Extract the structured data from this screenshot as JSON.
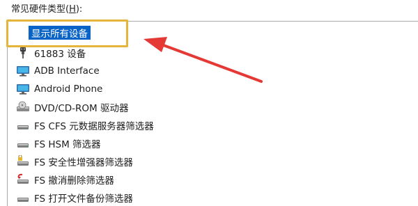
{
  "label": {
    "text": "常见硬件类型(",
    "accelerator": "H",
    "suffix": "):"
  },
  "list": {
    "items": [
      {
        "label": "显示所有设备",
        "icon": "none",
        "selected": true
      },
      {
        "label": "61883 设备",
        "icon": "firewire-plug-icon"
      },
      {
        "label": "ADB Interface",
        "icon": "monitor-icon"
      },
      {
        "label": "Android Phone",
        "icon": "monitor-icon"
      },
      {
        "label": "DVD/CD-ROM 驱动器",
        "icon": "optical-drive-icon"
      },
      {
        "label": "FS CFS 元数据服务器筛选器",
        "icon": "drive-icon"
      },
      {
        "label": "FS HSM 筛选器",
        "icon": "drive-icon"
      },
      {
        "label": "FS 安全性增强器筛选器",
        "icon": "secure-drive-icon"
      },
      {
        "label": "FS 撤消删除筛选器",
        "icon": "undelete-drive-icon"
      },
      {
        "label": "FS 打开文件备份筛选器",
        "icon": "drive-icon"
      }
    ]
  },
  "colors": {
    "selection": "#0a64c8",
    "highlight_box": "#e5b43a",
    "arrow": "#e53935"
  }
}
